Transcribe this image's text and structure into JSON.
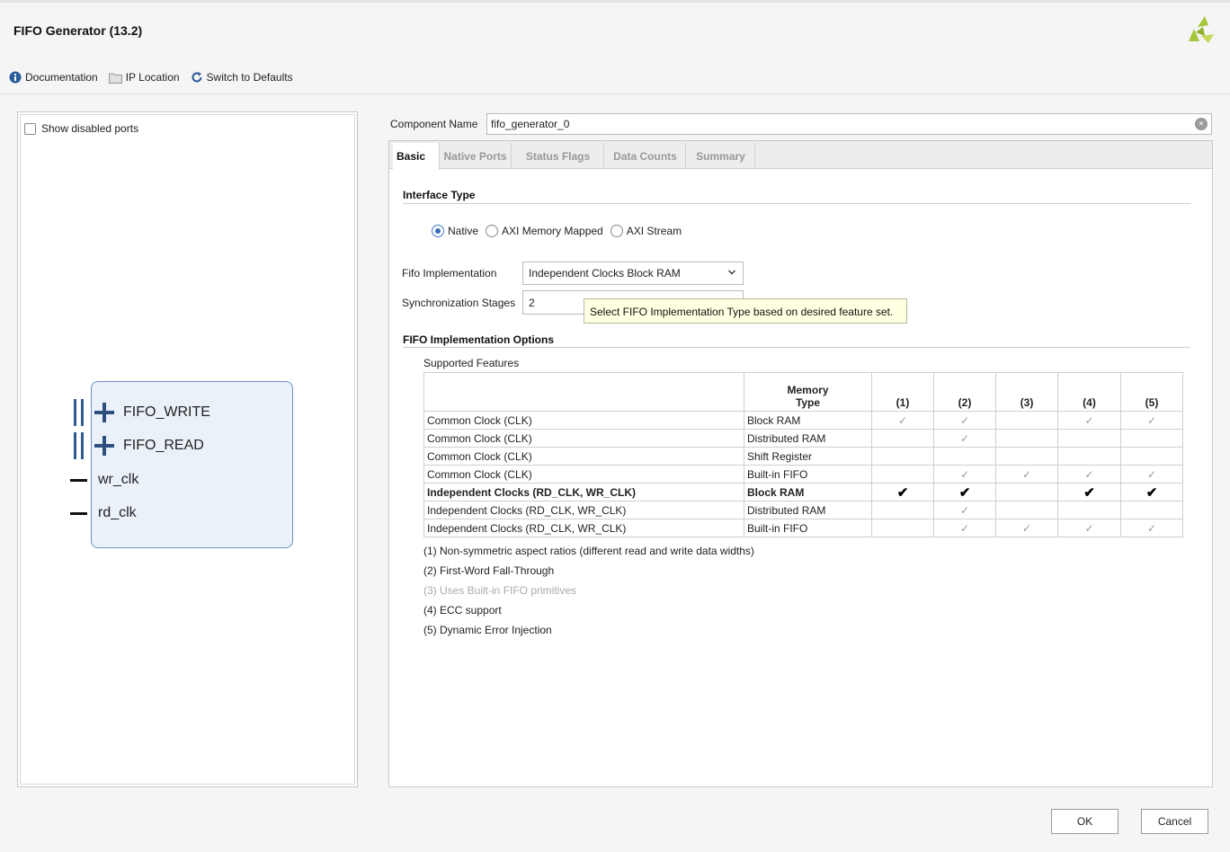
{
  "window": {
    "title": "FIFO Generator (13.2)"
  },
  "toolbar": {
    "documentation": "Documentation",
    "ip_location": "IP Location",
    "switch_defaults": "Switch to Defaults"
  },
  "left": {
    "show_disabled_ports": "Show disabled ports",
    "ports": {
      "fifo_write": "FIFO_WRITE",
      "fifo_read": "FIFO_READ",
      "wr_clk": "wr_clk",
      "rd_clk": "rd_clk"
    }
  },
  "component": {
    "label": "Component Name",
    "value": "fifo_generator_0"
  },
  "tabs": [
    "Basic",
    "Native Ports",
    "Status Flags",
    "Data Counts",
    "Summary"
  ],
  "basic": {
    "interface_type_title": "Interface Type",
    "interface_options": [
      "Native",
      "AXI Memory Mapped",
      "AXI Stream"
    ],
    "selected_interface": "Native",
    "fifo_impl_label": "Fifo Implementation",
    "fifo_impl_value": "Independent Clocks Block RAM",
    "sync_stages_label": "Synchronization Stages",
    "sync_stages_value": "2",
    "tooltip": "Select FIFO Implementation Type based on desired feature set.",
    "impl_options_title": "FIFO Implementation Options",
    "supported_features": "Supported Features"
  },
  "table": {
    "headers": [
      "",
      "Memory Type",
      "(1)",
      "(2)",
      "(3)",
      "(4)",
      "(5)"
    ],
    "header_memory_line1": "Memory",
    "header_memory_line2": "Type",
    "rows": [
      {
        "clock": "Common Clock (CLK)",
        "memory": "Block RAM",
        "checks": [
          "✓",
          "✓",
          "",
          "✓",
          "✓"
        ]
      },
      {
        "clock": "Common Clock (CLK)",
        "memory": "Distributed RAM",
        "checks": [
          "",
          "✓",
          "",
          "",
          ""
        ]
      },
      {
        "clock": "Common Clock (CLK)",
        "memory": "Shift Register",
        "checks": [
          "",
          "",
          "",
          "",
          ""
        ]
      },
      {
        "clock": "Common Clock (CLK)",
        "memory": "Built-in FIFO",
        "checks": [
          "",
          "✓",
          "✓",
          "✓",
          "✓"
        ]
      },
      {
        "clock": "Independent Clocks (RD_CLK, WR_CLK)",
        "memory": "Block RAM",
        "checks": [
          "✔",
          "✔",
          "",
          "✔",
          "✔"
        ]
      },
      {
        "clock": "Independent Clocks (RD_CLK, WR_CLK)",
        "memory": "Distributed RAM",
        "checks": [
          "",
          "✓",
          "",
          "",
          ""
        ]
      },
      {
        "clock": "Independent Clocks (RD_CLK, WR_CLK)",
        "memory": "Built-in FIFO",
        "checks": [
          "",
          "✓",
          "✓",
          "✓",
          "✓"
        ]
      }
    ]
  },
  "notes": [
    "(1) Non-symmetric aspect ratios (different read and write data widths)",
    "(2) First-Word Fall-Through",
    "(3) Uses Built-in FIFO primitives",
    "(4) ECC support",
    "(5) Dynamic Error Injection"
  ],
  "buttons": {
    "ok": "OK",
    "cancel": "Cancel"
  },
  "colors": {
    "accent": "#3a6fb5",
    "logo": "#a4c639",
    "tooltip_bg": "#ffffe1"
  }
}
